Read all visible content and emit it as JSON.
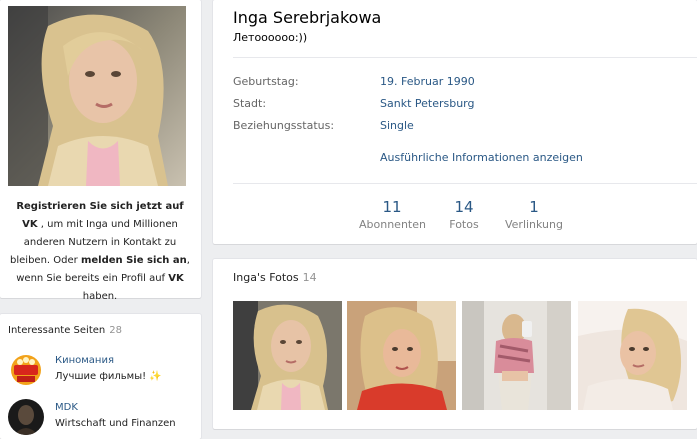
{
  "profile": {
    "name": "Inga Serebrjakowa",
    "status": "Летоооооо:))",
    "info": [
      {
        "label": "Geburtstag:",
        "value": "19. Februar 1990"
      },
      {
        "label": "Stadt:",
        "value": "Sankt Petersburg"
      },
      {
        "label": "Beziehungsstatus:",
        "value": "Single"
      }
    ],
    "show_more": "Ausführliche Informationen anzeigen",
    "counters": [
      {
        "num": "11",
        "label": "Abonnenten"
      },
      {
        "num": "14",
        "label": "Fotos"
      },
      {
        "num": "1",
        "label": "Verlinkung"
      }
    ]
  },
  "register": {
    "part1": "Registrieren Sie sich jetzt auf VK",
    "part2": " , um mit Inga und Millionen anderen Nutzern in Kontakt zu bleiben. Oder ",
    "part3": "melden Sie sich an",
    "part4": ", wenn Sie bereits ein Profil auf ",
    "part5": "VK",
    "part6": " haben."
  },
  "pages": {
    "title": "Interessante Seiten",
    "count": "28",
    "items": [
      {
        "name": "Киномания",
        "desc": "Лучшие фильмы! ✨",
        "icon": "kinomania-logo"
      },
      {
        "name": "MDK",
        "desc": "Wirtschaft und Finanzen",
        "icon": "mdk-logo"
      }
    ]
  },
  "photos": {
    "title": "Inga's Fotos",
    "count": "14"
  },
  "colors": {
    "link": "#2a5885",
    "background": "#edeef0",
    "label": "#656565"
  }
}
